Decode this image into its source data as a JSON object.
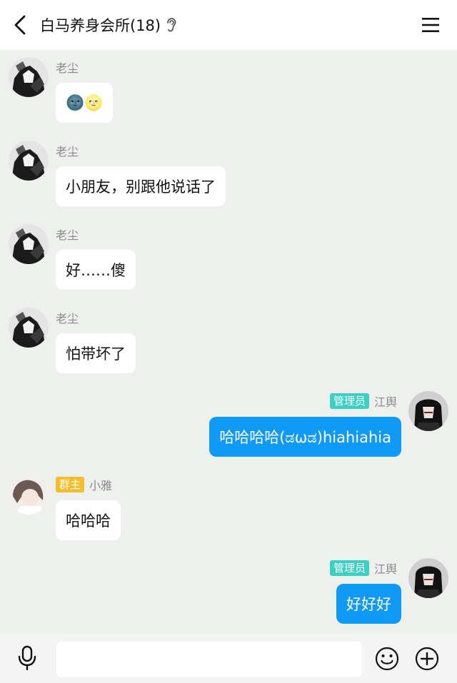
{
  "header": {
    "title": "白马养身会所(18)",
    "back_icon": "chevron-left-icon",
    "ear_icon": "ear-icon",
    "menu_icon": "hamburger-menu-icon"
  },
  "messages": [
    {
      "sender": "老尘",
      "text": "🌚🌝",
      "side": "left"
    },
    {
      "sender": "老尘",
      "text": "小朋友，别跟他说话了",
      "side": "left"
    },
    {
      "sender": "老尘",
      "text": "好……傻",
      "side": "left"
    },
    {
      "sender": "老尘",
      "text": "怕带坏了",
      "side": "left"
    },
    {
      "sender": "江舆",
      "badge": "管理员",
      "text": "哈哈哈哈(ಡωಡ)hiahiahia",
      "side": "right"
    },
    {
      "sender": "小雅",
      "badge": "群主",
      "text": "哈哈哈",
      "side": "left"
    },
    {
      "sender": "江舆",
      "badge": "管理员",
      "text": "好好好",
      "side": "right"
    }
  ],
  "input_bar": {
    "placeholder": "",
    "mic_icon": "microphone-icon",
    "emoji_icon": "smiley-icon",
    "plus_icon": "plus-circle-icon"
  },
  "colors": {
    "chat_background": "#eef0ee",
    "outgoing_bubble": "#1199f7",
    "admin_badge": "#3ccfc4",
    "owner_badge": "#f3bd2b"
  }
}
